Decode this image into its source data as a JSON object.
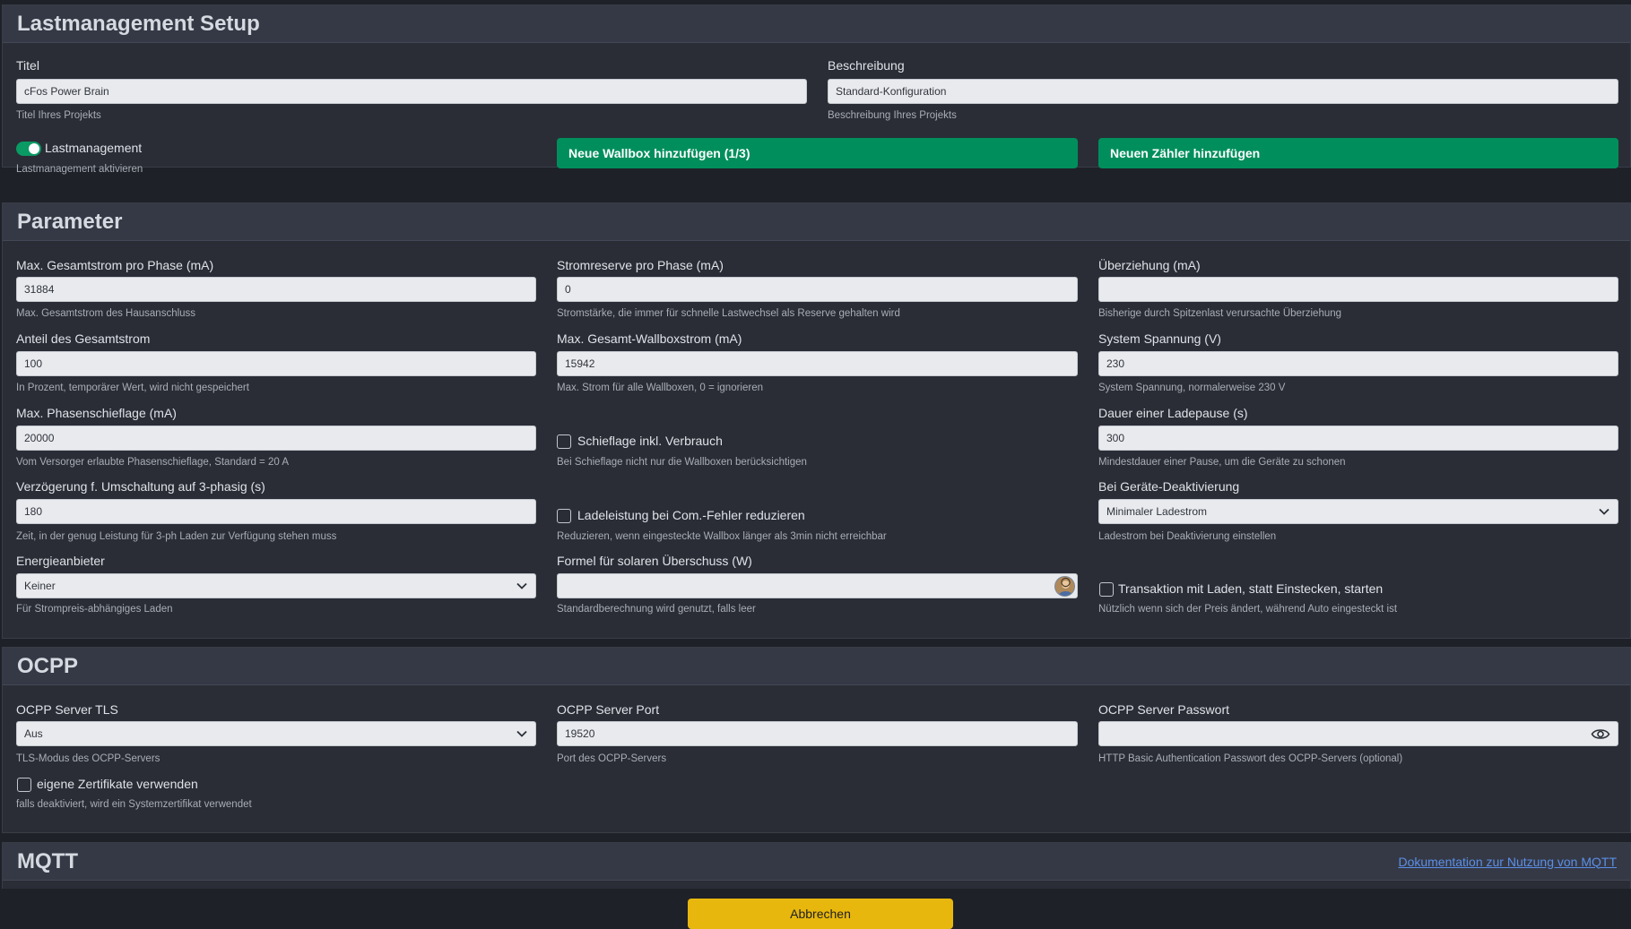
{
  "lastmanagement": {
    "title": "Lastmanagement Setup",
    "titel_label": "Titel",
    "titel_value": "cFos Power Brain",
    "titel_hint": "Titel Ihres Projekts",
    "beschreibung_label": "Beschreibung",
    "beschreibung_value": "Standard-Konfiguration",
    "beschreibung_hint": "Beschreibung Ihres Projekts",
    "toggle_label": "Lastmanagement",
    "toggle_hint": "Lastmanagement aktivieren",
    "toggle_on": true,
    "add_wallbox_button": "Neue Wallbox hinzufügen (1/3)",
    "add_meter_button": "Neuen Zähler hinzufügen"
  },
  "parameter": {
    "title": "Parameter",
    "max_gesamtstrom_label": "Max. Gesamtstrom pro Phase (mA)",
    "max_gesamtstrom_value": "31884",
    "max_gesamtstrom_hint": "Max. Gesamtstrom des Hausanschluss",
    "stromreserve_label": "Stromreserve pro Phase (mA)",
    "stromreserve_value": "0",
    "stromreserve_hint": "Stromstärke, die immer für schnelle Lastwechsel als Reserve gehalten wird",
    "ueberziehung_label": "Überziehung (mA)",
    "ueberziehung_value": "",
    "ueberziehung_hint": "Bisherige durch Spitzenlast verursachte Überziehung",
    "anteil_label": "Anteil des Gesamtstrom",
    "anteil_value": "100",
    "anteil_hint": "In Prozent, temporärer Wert, wird nicht gespeichert",
    "max_wallboxstrom_label": "Max. Gesamt-Wallboxstrom (mA)",
    "max_wallboxstrom_value": "15942",
    "max_wallboxstrom_hint": "Max. Strom für alle Wallboxen, 0 = ignorieren",
    "spannung_label": "System Spannung (V)",
    "spannung_value": "230",
    "spannung_hint": "System Spannung, normalerweise 230 V",
    "schieflage_label": "Max. Phasenschieflage (mA)",
    "schieflage_value": "20000",
    "schieflage_hint": "Vom Versorger erlaubte Phasenschieflage, Standard = 20 A",
    "schieflage_verbrauch_label": "Schieflage inkl. Verbrauch",
    "schieflage_verbrauch_hint": "Bei Schieflage nicht nur die Wallboxen berücksichtigen",
    "ladepause_label": "Dauer einer Ladepause (s)",
    "ladepause_value": "300",
    "ladepause_hint": "Mindestdauer einer Pause, um die Geräte zu schonen",
    "verzoegerung_label": "Verzögerung f. Umschaltung auf 3-phasig (s)",
    "verzoegerung_value": "180",
    "verzoegerung_hint": "Zeit, in der genug Leistung für 3-ph Laden zur Verfügung stehen muss",
    "ladeleistung_label": "Ladeleistung bei Com.-Fehler reduzieren",
    "ladeleistung_hint": "Reduzieren, wenn eingesteckte Wallbox länger als 3min nicht erreichbar",
    "deaktivierung_label": "Bei Geräte-Deaktivierung",
    "deaktivierung_value": "Minimaler Ladestrom",
    "deaktivierung_hint": "Ladestrom bei Deaktivierung einstellen",
    "energieanbieter_label": "Energieanbieter",
    "energieanbieter_value": "Keiner",
    "energieanbieter_hint": "Für Strompreis-abhängiges Laden",
    "formel_label": "Formel für solaren Überschuss (W)",
    "formel_value": "",
    "formel_hint": "Standardberechnung wird genutzt, falls leer",
    "transaktion_label": "Transaktion mit Laden, statt Einstecken, starten",
    "transaktion_hint": "Nützlich wenn sich der Preis ändert, während Auto eingesteckt ist"
  },
  "ocpp": {
    "title": "OCPP",
    "tls_label": "OCPP Server TLS",
    "tls_value": "Aus",
    "tls_hint": "TLS-Modus des OCPP-Servers",
    "port_label": "OCPP Server Port",
    "port_value": "19520",
    "port_hint": "Port des OCPP-Servers",
    "passwort_label": "OCPP Server Passwort",
    "passwort_value": "",
    "passwort_hint": "HTTP Basic Authentication Passwort des OCPP-Servers (optional)",
    "zertifikate_label": "eigene Zertifikate verwenden",
    "zertifikate_hint": "falls deaktiviert, wird ein Systemzertifikat verwendet"
  },
  "mqtt": {
    "title": "MQTT",
    "doc_link": "Dokumentation zur Nutzung von MQTT"
  },
  "footer": {
    "cancel_button": "Abbrechen"
  },
  "colors": {
    "background": "#1e2128",
    "card": "#2a2d36",
    "card_header": "#353945",
    "accent_green": "#008f5c",
    "cancel_yellow": "#e8b70d",
    "link_blue": "#5b8fe8"
  },
  "icons": {
    "select_chevron": "chevron-down-icon",
    "formula_assistant": "formula-avatar-icon",
    "password_visibility": "eye-icon"
  }
}
